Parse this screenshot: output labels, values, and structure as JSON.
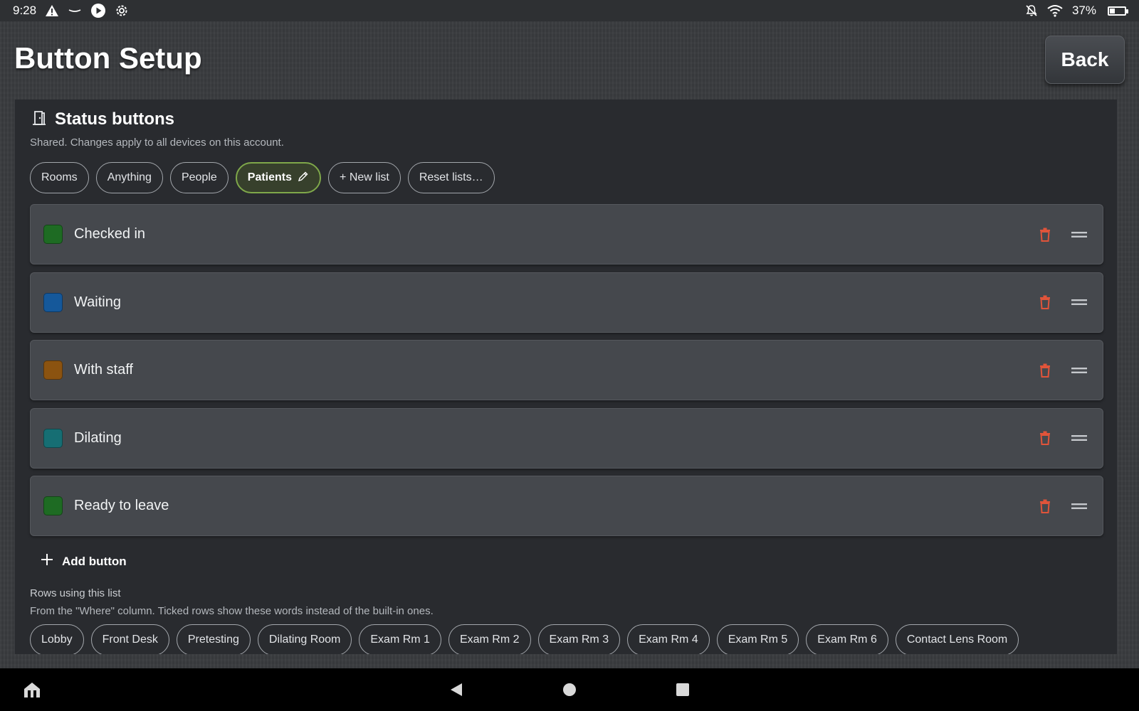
{
  "status_bar": {
    "time": "9:28",
    "battery_percent": "37%",
    "battery_level": 0.37,
    "left_icons": [
      "warning-icon",
      "dash-icon",
      "play-icon",
      "settings-icon"
    ],
    "right_icons": [
      "notifications-off-icon",
      "wifi-icon",
      "battery-charging-icon"
    ]
  },
  "header": {
    "title": "Button Setup",
    "back_label": "Back"
  },
  "panel": {
    "icon": "door-icon",
    "title": "Status buttons",
    "subtitle": "Shared. Changes apply to all devices on this account.",
    "tabs": [
      {
        "label": "Rooms",
        "active": false
      },
      {
        "label": "Anything",
        "active": false
      },
      {
        "label": "People",
        "active": false
      },
      {
        "label": "Patients",
        "active": true,
        "icon": "pencil-icon"
      },
      {
        "label": "+ New list",
        "active": false
      },
      {
        "label": "Reset lists…",
        "active": false
      }
    ],
    "items": [
      {
        "label": "Checked in",
        "color": "#1e6b23"
      },
      {
        "label": "Waiting",
        "color": "#15589a"
      },
      {
        "label": "With staff",
        "color": "#8b5310"
      },
      {
        "label": "Dilating",
        "color": "#166e73"
      },
      {
        "label": "Ready to leave",
        "color": "#1e6b23"
      }
    ],
    "item_actions": {
      "delete_icon": "trash-icon",
      "drag_icon": "drag-handle-icon",
      "delete_color": "#e0543a"
    },
    "add_button_label": "Add button",
    "rows_label": "Rows using this list",
    "rows_sub": "From the \"Where\" column. Ticked rows show these words instead of the built-in ones.",
    "where_rows": [
      "Lobby",
      "Front Desk",
      "Pretesting",
      "Dilating Room",
      "Exam Rm 1",
      "Exam Rm 2",
      "Exam Rm 3",
      "Exam Rm 4",
      "Exam Rm 5",
      "Exam Rm 6",
      "Contact Lens Room"
    ]
  },
  "nav_bar": {
    "icons": [
      "home-icon",
      "back-triangle-icon",
      "home-circle-icon",
      "recents-square-icon"
    ]
  }
}
